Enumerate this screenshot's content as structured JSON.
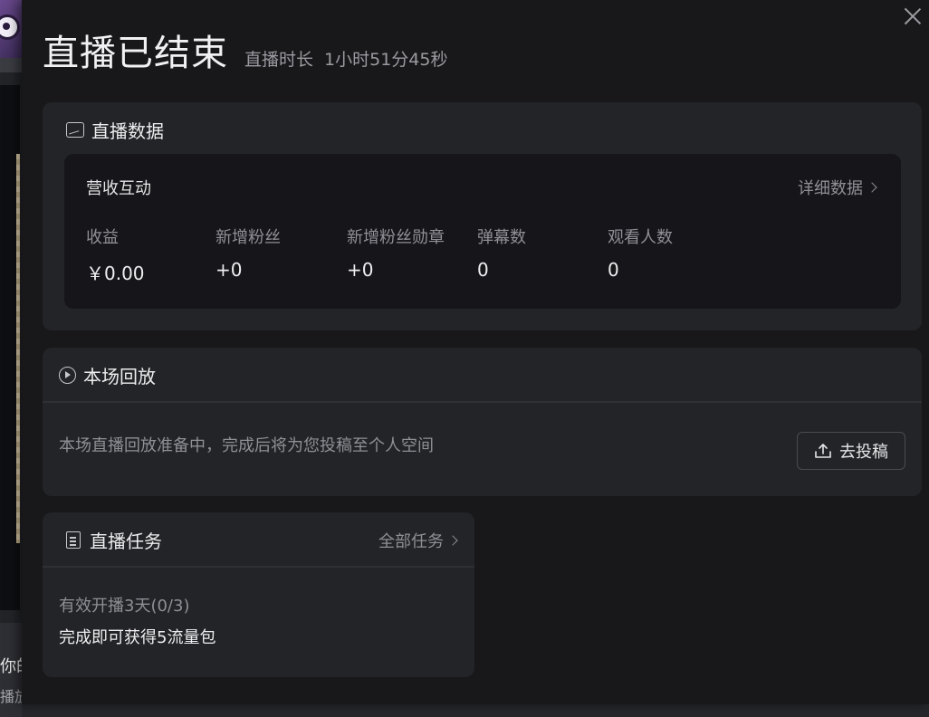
{
  "background": {
    "text_line_1": "你的",
    "text_line_2": "播放"
  },
  "header": {
    "title": "直播已结束",
    "duration_label": "直播时长",
    "duration_value": "1小时51分45秒"
  },
  "live_data": {
    "section_title": "直播数据",
    "panel_title": "营收互动",
    "detail_link": "详细数据",
    "metrics": [
      {
        "label": "收益",
        "value": "￥0.00"
      },
      {
        "label": "新增粉丝",
        "value": "+0"
      },
      {
        "label": "新增粉丝勋章",
        "value": "+0"
      },
      {
        "label": "弹幕数",
        "value": "0"
      },
      {
        "label": "观看人数",
        "value": "0"
      }
    ]
  },
  "replay": {
    "section_title": "本场回放",
    "message": "本场直播回放准备中，完成后将为您投稿至个人空间",
    "upload_button": "去投稿"
  },
  "tasks": {
    "section_title": "直播任务",
    "all_tasks_link": "全部任务",
    "task_name": "有效开播3天(0/3)",
    "task_reward": "完成即可获得5流量包"
  },
  "icons": {
    "close": "close-icon",
    "live_data": "chart-icon",
    "replay": "play-circle-icon",
    "upload": "upload-icon",
    "tasks": "document-icon",
    "chevron": "chevron-right-icon"
  }
}
